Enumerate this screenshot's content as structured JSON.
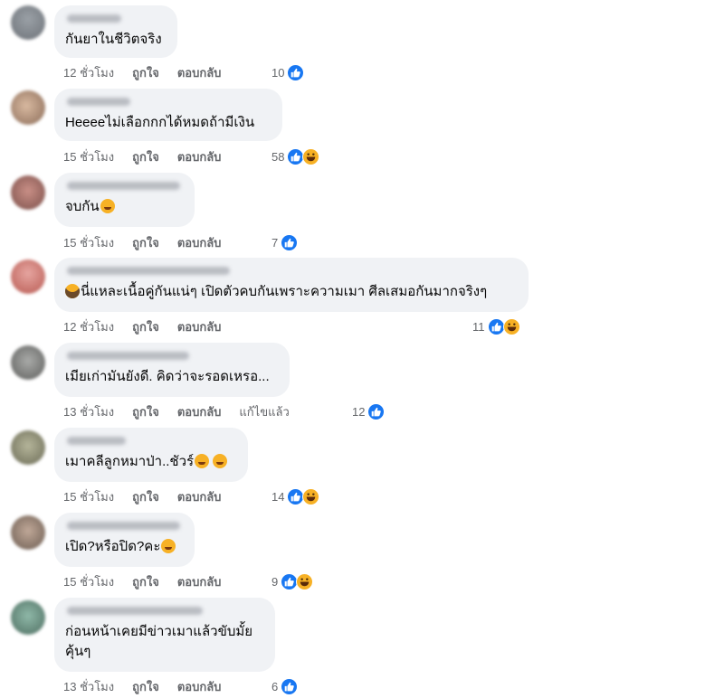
{
  "colors": {
    "like": "#1877f2",
    "haha": "#f7b125",
    "bubble": "#f0f2f5",
    "meta": "#65676b"
  },
  "action_labels": {
    "like": "ถูกใจ",
    "reply": "ตอบกลับ",
    "edited": "แก้ไขแล้ว"
  },
  "comments": [
    {
      "text": "กันยาในชีวิตจริง",
      "time": "12 ชั่วโมง",
      "reaction_count": "10",
      "reactions": [
        "like-icon"
      ]
    },
    {
      "text": "Heeeeไม่เลือกกกได้หมดถ้ามีเงิน",
      "time": "15 ชั่วโมง",
      "reaction_count": "58",
      "reactions": [
        "like-icon",
        "haha-icon"
      ]
    },
    {
      "text": "จบกัน",
      "time": "15 ชั่วโมง",
      "reaction_count": "7",
      "reactions": [
        "like-icon"
      ],
      "emoji": "laugh-cry-emoji"
    },
    {
      "text": "นี่แหละเนื้อคู่กันแน่ๆ เปิดตัวคบกันเพราะความเมา ศีลเสมอกันมากจริงๆ",
      "time": "12 ชั่วโมง",
      "reaction_count": "11",
      "reactions": [
        "like-icon",
        "haha-icon"
      ],
      "emoji_prefix": "detective-emoji"
    },
    {
      "text": "เมียเก่ามันยังดี. คิดว่าจะรอดเหรอ...",
      "time": "13 ชั่วโมง",
      "reaction_count": "12",
      "reactions": [
        "like-icon"
      ],
      "edited": true
    },
    {
      "text": "เมาคลีลูกหมาป่า..ชัวร์",
      "time": "15 ชั่วโมง",
      "reaction_count": "14",
      "reactions": [
        "like-icon",
        "haha-icon"
      ],
      "emoji": "relieved-emoji"
    },
    {
      "text": "เปิด?หรือปิด?คะ",
      "time": "15 ชั่วโมง",
      "reaction_count": "9",
      "reactions": [
        "like-icon",
        "haha-icon"
      ],
      "emoji": "grin-emoji"
    },
    {
      "text": "ก่อนหน้าเคยมีข่าวเมาแล้วขับมั้ย\nคุ้นๆ",
      "time": "13 ชั่วโมง",
      "reaction_count": "6",
      "reactions": [
        "like-icon"
      ]
    }
  ]
}
